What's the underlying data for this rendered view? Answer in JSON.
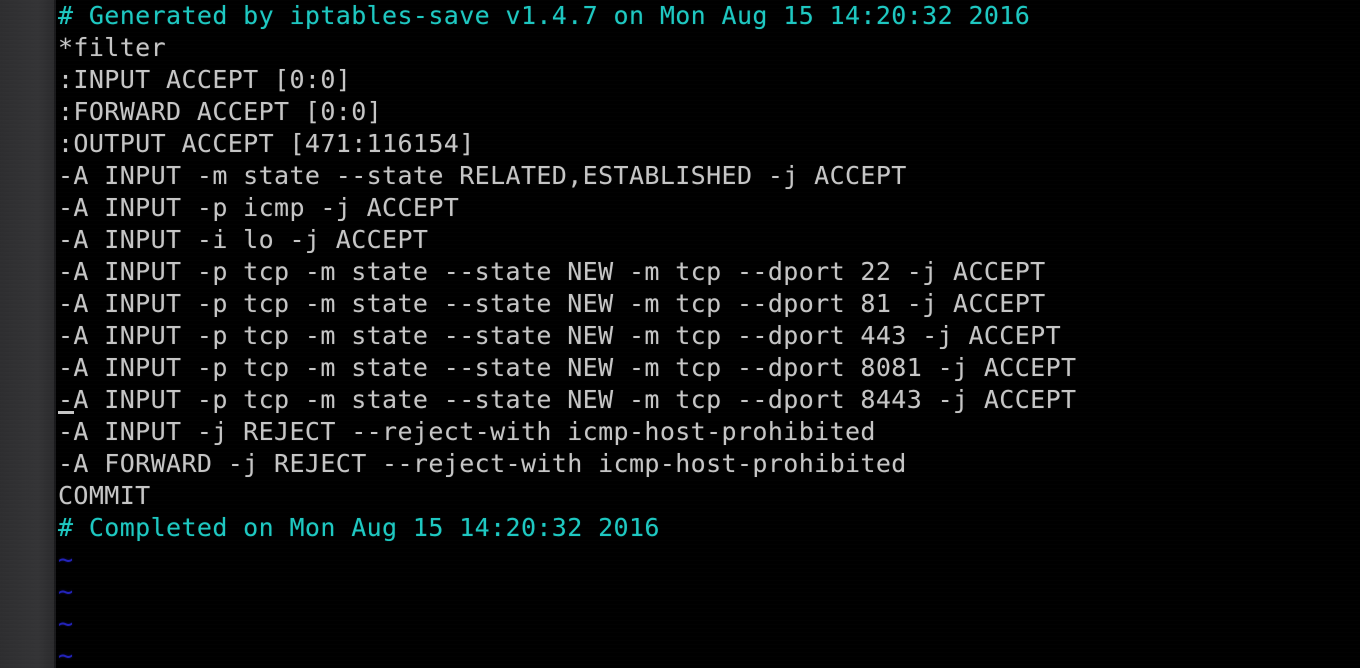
{
  "window": {
    "title": "iptables-save output",
    "gutter_color": "#303032",
    "background_color": "#000000"
  },
  "terminal": {
    "foreground_color": "#c6c6c6",
    "comment_color": "#1ec9c2",
    "tilde_color": "#2222bb",
    "font_size_px": 25,
    "line_height_px": 32,
    "cursor": {
      "line_index": 12,
      "column": 0,
      "style": "underline"
    },
    "lines": [
      {
        "text": "# Generated by iptables-save v1.4.7 on Mon Aug 15 14:20:32 2016",
        "kind": "comment"
      },
      {
        "text": "*filter",
        "kind": "normal"
      },
      {
        "text": ":INPUT ACCEPT [0:0]",
        "kind": "normal"
      },
      {
        "text": ":FORWARD ACCEPT [0:0]",
        "kind": "normal"
      },
      {
        "text": ":OUTPUT ACCEPT [471:116154]",
        "kind": "normal"
      },
      {
        "text": "-A INPUT -m state --state RELATED,ESTABLISHED -j ACCEPT",
        "kind": "normal"
      },
      {
        "text": "-A INPUT -p icmp -j ACCEPT",
        "kind": "normal"
      },
      {
        "text": "-A INPUT -i lo -j ACCEPT",
        "kind": "normal"
      },
      {
        "text": "-A INPUT -p tcp -m state --state NEW -m tcp --dport 22 -j ACCEPT",
        "kind": "normal"
      },
      {
        "text": "-A INPUT -p tcp -m state --state NEW -m tcp --dport 81 -j ACCEPT",
        "kind": "normal"
      },
      {
        "text": "-A INPUT -p tcp -m state --state NEW -m tcp --dport 443 -j ACCEPT",
        "kind": "normal"
      },
      {
        "text": "-A INPUT -p tcp -m state --state NEW -m tcp --dport 8081 -j ACCEPT",
        "kind": "normal"
      },
      {
        "text": "-A INPUT -p tcp -m state --state NEW -m tcp --dport 8443 -j ACCEPT",
        "kind": "normal"
      },
      {
        "text": "-A INPUT -j REJECT --reject-with icmp-host-prohibited",
        "kind": "normal"
      },
      {
        "text": "-A FORWARD -j REJECT --reject-with icmp-host-prohibited",
        "kind": "normal"
      },
      {
        "text": "COMMIT",
        "kind": "normal"
      },
      {
        "text": "# Completed on Mon Aug 15 14:20:32 2016",
        "kind": "comment"
      },
      {
        "text": "~",
        "kind": "tilde"
      },
      {
        "text": "~",
        "kind": "tilde"
      },
      {
        "text": "~",
        "kind": "tilde"
      },
      {
        "text": "~",
        "kind": "tilde"
      }
    ]
  }
}
